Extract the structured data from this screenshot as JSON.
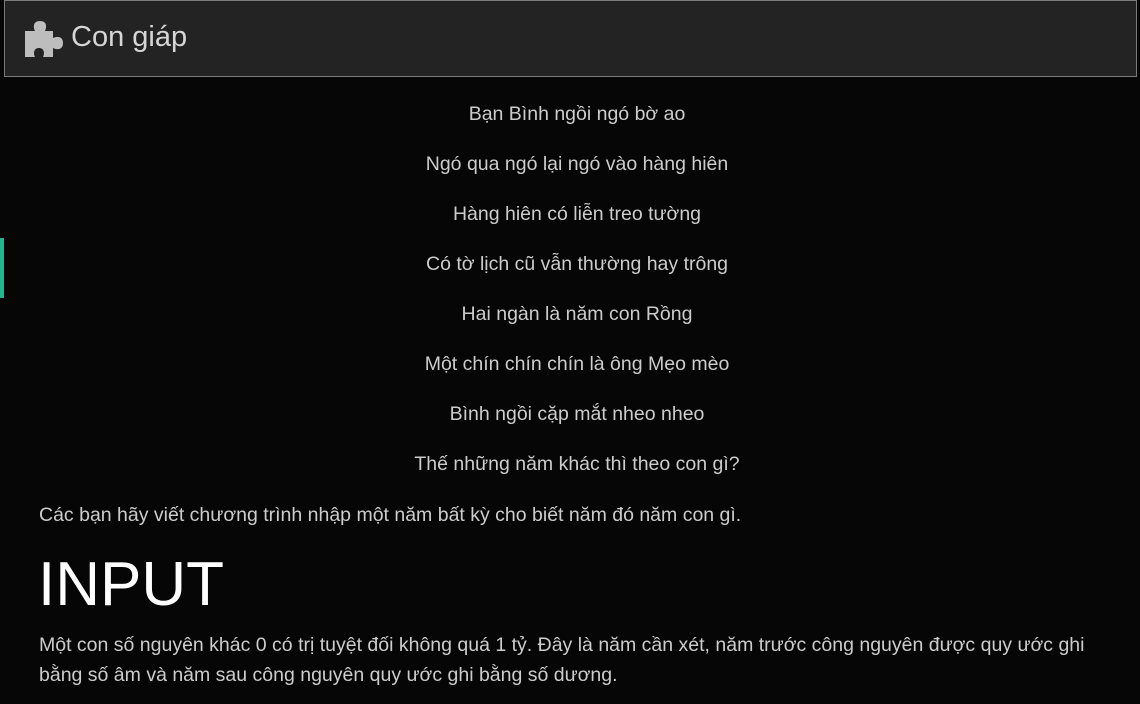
{
  "header": {
    "icon": "puzzle-piece-icon",
    "title": "Con giáp"
  },
  "accent_color": "#1fb58f",
  "poem": {
    "lines": [
      "Bạn Bình ngồi ngó bờ ao",
      "Ngó qua ngó lại ngó vào hàng hiên",
      "Hàng hiên có liễn treo tường",
      "Có tờ lịch cũ vẫn thường hay trông",
      "Hai ngàn là năm con Rồng",
      "Một chín chín chín là ông Mẹo mèo",
      "Bình ngồi cặp mắt nheo nheo",
      "Thế những năm khác thì theo con gì?"
    ]
  },
  "prompt": "Các bạn hãy viết chương trình nhập một năm bất kỳ cho biết năm đó năm con gì.",
  "input_section": {
    "heading": "INPUT",
    "description": "Một con số nguyên khác 0 có trị tuyệt đối không quá 1 tỷ. Đây là năm cần xét, năm trước công nguyên được quy ước ghi bằng số âm và năm sau công nguyên quy ước ghi bằng số dương."
  }
}
